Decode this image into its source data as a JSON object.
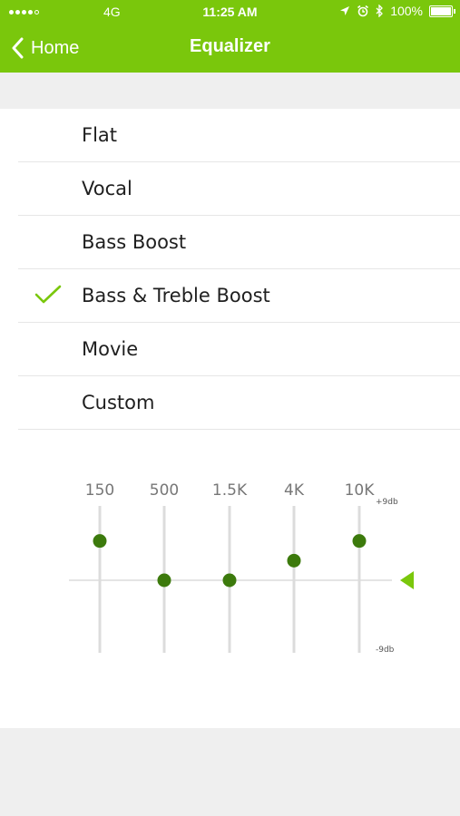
{
  "status_bar": {
    "network": "4G",
    "time": "11:25 AM",
    "battery": "100%",
    "signal_dots_filled": 4,
    "signal_dots_total": 5,
    "icons": [
      "location-arrow-icon",
      "alarm-icon",
      "bluetooth-icon",
      "battery-icon"
    ]
  },
  "nav": {
    "back_label": "Home",
    "title": "Equalizer",
    "back_icon": "chevron-left-icon"
  },
  "presets": {
    "selected_index": 3,
    "items": [
      {
        "label": "Flat"
      },
      {
        "label": "Vocal"
      },
      {
        "label": "Bass Boost"
      },
      {
        "label": "Bass & Treble Boost"
      },
      {
        "label": "Movie"
      },
      {
        "label": "Custom"
      }
    ]
  },
  "equalizer": {
    "max_label": "+9db",
    "min_label": "-9db",
    "range_db": [
      -9,
      9
    ],
    "bands": [
      {
        "label": "150",
        "gain_db": 5
      },
      {
        "label": "500",
        "gain_db": 0
      },
      {
        "label": "1.5K",
        "gain_db": 0
      },
      {
        "label": "4K",
        "gain_db": 2.5
      },
      {
        "label": "10K",
        "gain_db": 5
      }
    ]
  },
  "colors": {
    "accent": "#7ac70c",
    "knob": "#3c7a0c",
    "track": "#dcdcdc"
  }
}
